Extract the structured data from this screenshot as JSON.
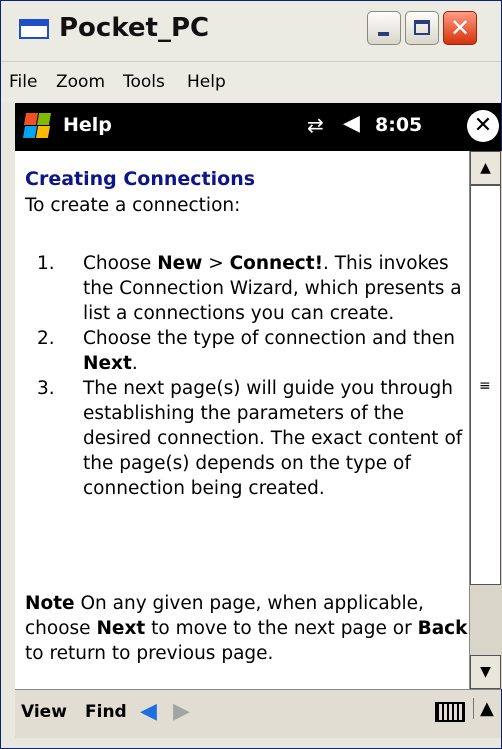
{
  "window": {
    "title": "Pocket_PC",
    "menu": [
      "File",
      "Zoom",
      "Tools",
      "Help"
    ]
  },
  "status_bar": {
    "app_title": "Help",
    "time": "8:05",
    "icons": [
      "windows-start-icon",
      "connection-icon",
      "volume-icon",
      "ok-close-icon"
    ]
  },
  "content": {
    "heading": "Creating Connections",
    "intro": "To create a connection:",
    "steps": [
      {
        "num": "1.",
        "parts": [
          {
            "text": "Choose "
          },
          {
            "text": "New",
            "bold": true
          },
          {
            "text": " > "
          },
          {
            "text": "Connect!",
            "bold": true
          },
          {
            "text": ". This invokes the Connection Wizard, which presents a list a connections you can create."
          }
        ]
      },
      {
        "num": "2.",
        "parts": [
          {
            "text": "Choose the type of connection and then "
          },
          {
            "text": "Next",
            "bold": true
          },
          {
            "text": "."
          }
        ]
      },
      {
        "num": "3.",
        "parts": [
          {
            "text": "The next page(s) will guide you through establishing the parameters of the desired connection. The exact content of the page(s) depends on the type of connection being created."
          }
        ]
      }
    ],
    "note": {
      "label": "Note",
      "parts": [
        {
          "text": " On any given page, when applicable, choose "
        },
        {
          "text": "Next",
          "bold": true
        },
        {
          "text": " to move to the next page or "
        },
        {
          "text": "Back",
          "bold": true
        },
        {
          "text": " to return to previous page."
        }
      ]
    }
  },
  "bottom_bar": {
    "view_label": "View",
    "find_label": "Find",
    "icons": [
      "back-arrow-icon",
      "forward-arrow-icon",
      "keyboard-icon",
      "input-menu-arrow-icon"
    ]
  },
  "colors": {
    "heading": "#0d1688",
    "status_bar_bg": "#000000",
    "back_arrow": "#1d6fe0",
    "close_button": "#d6320c"
  }
}
